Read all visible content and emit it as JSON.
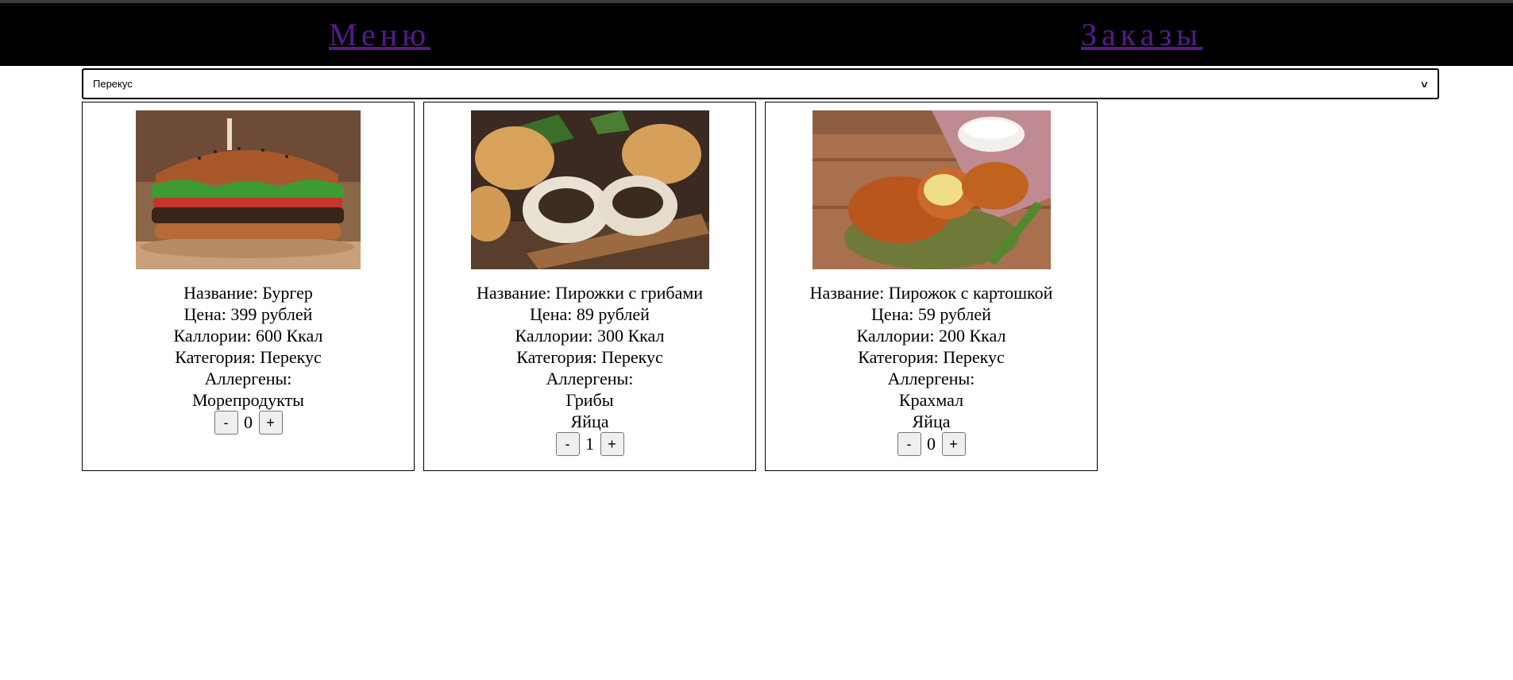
{
  "nav": {
    "menu_label": "Меню",
    "orders_label": "Заказы"
  },
  "filter": {
    "selected": "Перекус"
  },
  "products": [
    {
      "image_icon": "burger-image",
      "name_line": "Название: Бургер",
      "price_line": "Цена: 399 рублей",
      "calories_line": "Каллории: 600 Ккал",
      "category_line": "Категория: Перекус",
      "allergens_label": "Аллергены:",
      "allergens": [
        "Морепродукты"
      ],
      "quantity": "0"
    },
    {
      "image_icon": "mushroom-pies-image",
      "name_line": "Название: Пирожки с грибами",
      "price_line": "Цена: 89 рублей",
      "calories_line": "Каллории: 300 Ккал",
      "category_line": "Категория: Перекус",
      "allergens_label": "Аллергены:",
      "allergens": [
        "Грибы",
        "Яйца"
      ],
      "quantity": "1"
    },
    {
      "image_icon": "potato-pie-image",
      "name_line": "Название: Пирожок с картошкой",
      "price_line": "Цена: 59 рублей",
      "calories_line": "Каллории: 200 Ккал",
      "category_line": "Категория: Перекус",
      "allergens_label": "Аллергены:",
      "allergens": [
        "Крахмал",
        "Яйца"
      ],
      "quantity": "0"
    }
  ],
  "buttons": {
    "minus": "-",
    "plus": "+"
  },
  "colors": {
    "navbar_bg": "#000000",
    "link": "#551a8b"
  }
}
